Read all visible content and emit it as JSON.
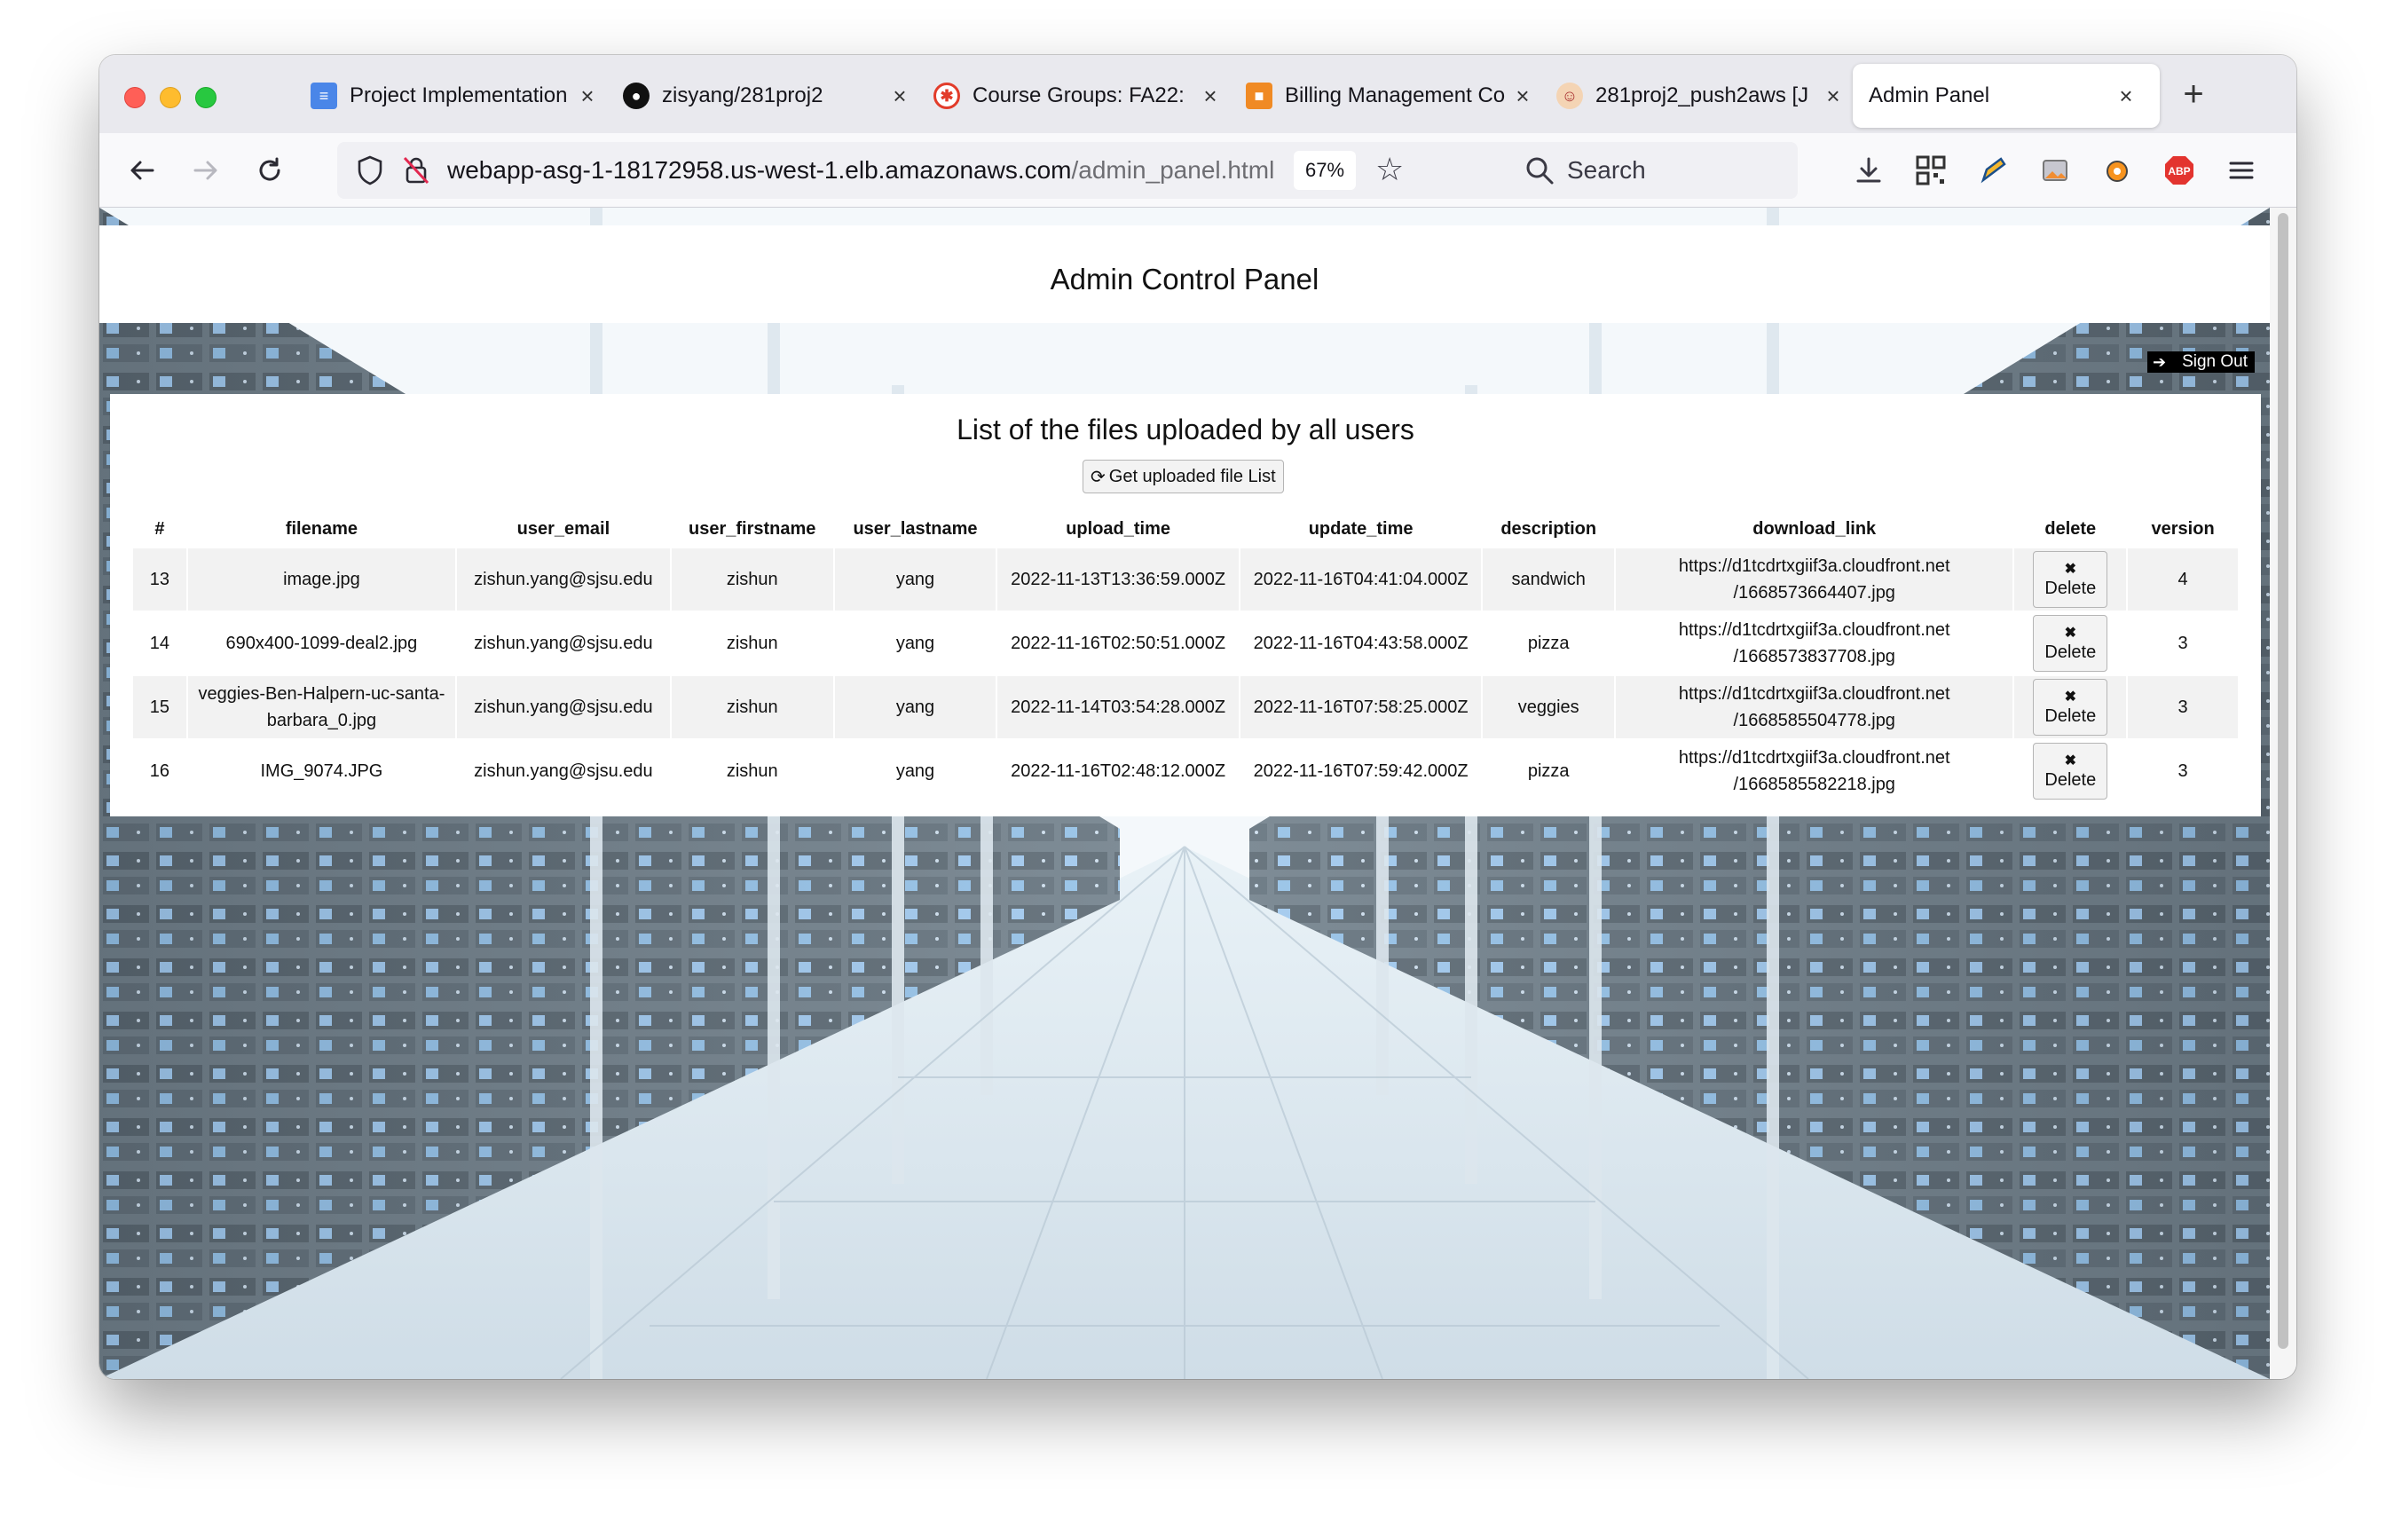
{
  "browser": {
    "tabs": [
      {
        "title": "Project Implementation",
        "icon": "google-docs-icon",
        "active": false
      },
      {
        "title": "zisyang/281proj2",
        "icon": "github-icon",
        "active": false
      },
      {
        "title": "Course Groups: FA22:",
        "icon": "canvas-icon",
        "active": false
      },
      {
        "title": "Billing Management Co",
        "icon": "aws-icon",
        "active": false
      },
      {
        "title": "281proj2_push2aws [J",
        "icon": "jenkins-icon",
        "active": false
      },
      {
        "title": "Admin Panel",
        "icon": "",
        "active": true
      }
    ],
    "url_host": "webapp-asg-1-18172958.us-west-1.elb.amazonaws.com",
    "url_path": "/admin_panel.html",
    "zoom": "67%",
    "search_placeholder": "Search"
  },
  "page": {
    "title": "Admin Control Panel",
    "signout_label": "Sign Out",
    "panel_title": "List of the files uploaded by all users",
    "get_button_label": "Get uploaded file List",
    "delete_label": "Delete"
  },
  "table": {
    "columns": [
      "#",
      "filename",
      "user_email",
      "user_firstname",
      "user_lastname",
      "upload_time",
      "update_time",
      "description",
      "download_link",
      "delete",
      "version"
    ],
    "rows": [
      {
        "id": "13",
        "filename": "image.jpg",
        "email": "zishun.yang@sjsu.edu",
        "first": "zishun",
        "last": "yang",
        "upload": "2022-11-13T13:36:59.000Z",
        "update": "2022-11-16T04:41:04.000Z",
        "description": "sandwich",
        "link1": "https://d1tcdrtxgiif3a.cloudfront.net",
        "link2": "/1668573664407.jpg",
        "version": "4"
      },
      {
        "id": "14",
        "filename": "690x400-1099-deal2.jpg",
        "email": "zishun.yang@sjsu.edu",
        "first": "zishun",
        "last": "yang",
        "upload": "2022-11-16T02:50:51.000Z",
        "update": "2022-11-16T04:43:58.000Z",
        "description": "pizza",
        "link1": "https://d1tcdrtxgiif3a.cloudfront.net",
        "link2": "/1668573837708.jpg",
        "version": "3"
      },
      {
        "id": "15",
        "filename": "veggies-Ben-Halpern-uc-santa-barbara_0.jpg",
        "email": "zishun.yang@sjsu.edu",
        "first": "zishun",
        "last": "yang",
        "upload": "2022-11-14T03:54:28.000Z",
        "update": "2022-11-16T07:58:25.000Z",
        "description": "veggies",
        "link1": "https://d1tcdrtxgiif3a.cloudfront.net",
        "link2": "/1668585504778.jpg",
        "version": "3"
      },
      {
        "id": "16",
        "filename": "IMG_9074.JPG",
        "email": "zishun.yang@sjsu.edu",
        "first": "zishun",
        "last": "yang",
        "upload": "2022-11-16T02:48:12.000Z",
        "update": "2022-11-16T07:59:42.000Z",
        "description": "pizza",
        "link1": "https://d1tcdrtxgiif3a.cloudfront.net",
        "link2": "/1668585582218.jpg",
        "version": "3"
      }
    ]
  },
  "colors": {
    "signout_bg": "#000000",
    "stripe": "#f2f2f2",
    "tab_active": "#ffffff"
  }
}
